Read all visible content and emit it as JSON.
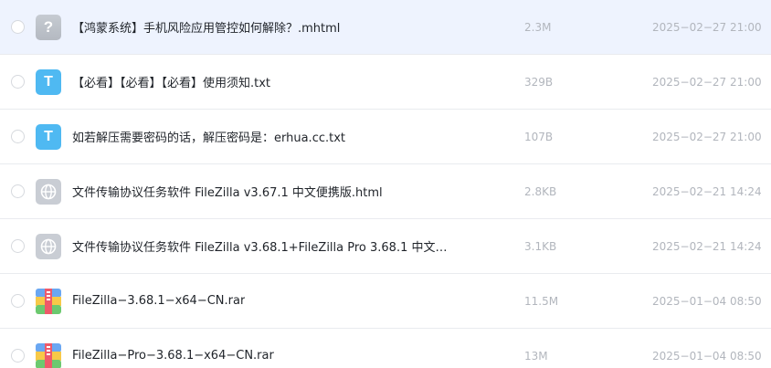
{
  "files": [
    {
      "icon": "unknown",
      "icon_glyph": "?",
      "name": "【鸿蒙系统】手机风险应用管控如何解除？.mhtml",
      "size": "2.3M",
      "date": "2025−02−27 21:00",
      "selected": true
    },
    {
      "icon": "txt",
      "icon_glyph": "T",
      "name": "【必看】【必看】【必看】使用须知.txt",
      "size": "329B",
      "date": "2025−02−27 21:00"
    },
    {
      "icon": "txt",
      "icon_glyph": "T",
      "name": "如若解压需要密码的话，解压密码是：erhua.cc.txt",
      "size": "107B",
      "date": "2025−02−27 21:00"
    },
    {
      "icon": "html",
      "name": "文件传输协议任务软件 FileZilla v3.67.1 中文便携版.html",
      "size": "2.8KB",
      "date": "2025−02−21 14:24"
    },
    {
      "icon": "html",
      "name": "文件传输协议任务软件 FileZilla v3.68.1+FileZilla Pro 3.68.1 中文便携...",
      "size": "3.1KB",
      "date": "2025−02−21 14:24"
    },
    {
      "icon": "rar",
      "name": "FileZilla−3.68.1−x64−CN.rar",
      "size": "11.5M",
      "date": "2025−01−04 08:50"
    },
    {
      "icon": "rar",
      "name": "FileZilla−Pro−3.68.1−x64−CN.rar",
      "size": "13M",
      "date": "2025−01−04 08:50"
    }
  ]
}
